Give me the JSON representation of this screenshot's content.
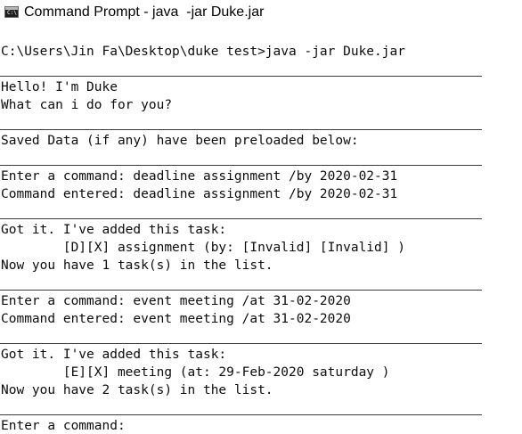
{
  "window": {
    "title": "Command Prompt - java  -jar Duke.jar",
    "icon": "cmd-icon",
    "icon_glyph": "C:\\"
  },
  "console": {
    "command": "C:\\Users\\Jin Fa\\Desktop\\duke test>java -jar Duke.jar",
    "greeting": [
      "Hello! I'm Duke",
      "What can i do for you?"
    ],
    "preload_notice": "Saved Data (if any) have been preloaded below:",
    "exchange1": {
      "prompt": "Enter a command: deadline assignment /by 2020-02-31",
      "echo": "Command entered: deadline assignment /by 2020-02-31"
    },
    "response1": {
      "header": "Got it. I've added this task:",
      "task": "        [D][X] assignment (by: [Invalid] [Invalid] )",
      "count": "Now you have 1 task(s) in the list."
    },
    "exchange2": {
      "prompt": "Enter a command: event meeting /at 31-02-2020",
      "echo": "Command entered: event meeting /at 31-02-2020"
    },
    "response2": {
      "header": "Got it. I've added this task:",
      "task": "        [E][X] meeting (at: 29-Feb-2020 saturday )",
      "count": "Now you have 2 task(s) in the list."
    },
    "final_prompt": "Enter a command: "
  }
}
